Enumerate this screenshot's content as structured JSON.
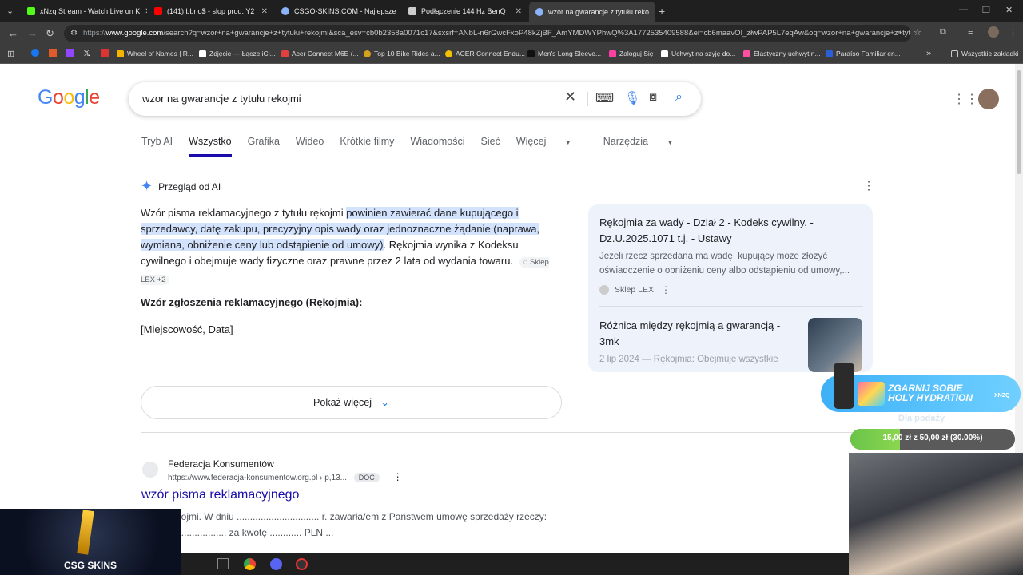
{
  "browser": {
    "tabs": [
      {
        "title": "xNzq Stream - Watch Live on K",
        "color": "#53fc18"
      },
      {
        "title": "(141) bbno$ - slop prod. Y2",
        "color": "#ff0000"
      },
      {
        "title": "CSGO-SKINS.COM - Najlepsze",
        "color": "#8ab4f8"
      },
      {
        "title": "Podłączenie 144 Hz BenQ",
        "color": "#cccccc"
      },
      {
        "title": "wzor na gwarancje z tytułu reko",
        "color": "#8ab4f8"
      }
    ],
    "url_prefix": "https://",
    "url_domain": "www.google.com",
    "url_rest": "/search?q=wzor+na+gwarancje+z+tytułu+rekojmi&sca_esv=cb0b2358a0071c17&sxsrf=ANbL-n6rGwcFxoP48kZjBF_AmYMDWYPhwQ%3A1772535409588&ei=cb6maavOI_złwPAP5L7eqAw&oq=wzor+na+gwarancje+z+tytu+...",
    "bookmarks": [
      {
        "label": "Wheel of Names | R...",
        "color": "#f4b400"
      },
      {
        "label": "Zdjęcie — Łącze iCl...",
        "color": "#ffffff"
      },
      {
        "label": "Acer Connect M6E (...",
        "color": "#e04040"
      },
      {
        "label": "Top 10 Bike Rides a...",
        "color": "#d6a21e"
      },
      {
        "label": "ACER Connect Endu...",
        "color": "#f2c200"
      },
      {
        "label": "Men's Long Sleeve...",
        "color": "#000000"
      },
      {
        "label": "Zaloguj Się",
        "color": "#ff3fa4"
      },
      {
        "label": "Uchwyt na szyję do...",
        "color": "#ffffff"
      },
      {
        "label": "Elastyczny uchwyt n...",
        "color": "#ff4fa0"
      },
      {
        "label": "Paraíso Familiar en...",
        "color": "#2b5fd9"
      }
    ],
    "all_bookmarks": "Wszystkie zakładki"
  },
  "search": {
    "query": "wzor na gwarancje z tytułu rekojmi",
    "tabs": [
      "Tryb AI",
      "Wszystko",
      "Grafika",
      "Wideo",
      "Krótkie filmy",
      "Wiadomości",
      "Sieć",
      "Więcej",
      "Narzędzia"
    ],
    "active_tab": "Wszystko"
  },
  "ai_overview": {
    "heading": "Przegląd od AI",
    "p1_lead": "Wzór pisma reklamacyjnego z tytułu rękojmi ",
    "p1_highlight": "powinien zawierać dane kupującego i sprzedawcy, datę zakupu, precyzyjny opis wady oraz jednoznaczne żądanie (naprawa, wymiana, obniżenie ceny lub odstąpienie od umowy)",
    "p1_tail": ". Rękojmia wynika z Kodeksu cywilnego i obejmuje wady fizyczne oraz prawne przez 2 lata od wydania towaru.",
    "source_chip": "Sklep LEX +2",
    "subheading": "Wzór zgłoszenia reklamacyjnego (Rękojmia):",
    "placeholder_line": "[Miejscowość, Data]",
    "show_more": "Pokaż więcej",
    "sources": [
      {
        "title": "Rękojmia za wady - Dział 2 - Kodeks cywilny. - Dz.U.2025.1071 t.j. - Ustawy",
        "snippet": "Jeżeli rzecz sprzedana ma wadę, kupujący może złożyć oświadczenie o obniżeniu ceny albo odstąpieniu od umowy,...",
        "site": "Sklep LEX"
      },
      {
        "title": "Różnica między rękojmią a gwarancją - 3mk",
        "snippet": "2 lip 2024 — Rękojmia: Obejmuje wszystkie"
      }
    ]
  },
  "result": {
    "site": "Federacja Konsumentów",
    "url": "https://www.federacja-konsumentow.org.pl › p,13...",
    "badge": "DOC",
    "title": "wzór pisma reklamacyjnego",
    "snippet_line1": "rękojmi. W dniu ............................... r. zawarła/em z Państwem umowę sprzedaży rzeczy:",
    "snippet_line2": "...................... za kwotę ............ PLN ..."
  },
  "stream_overlay": {
    "brand": "CSG SKINS",
    "promo_line1": "ZGARNIJ SOBIE",
    "promo_line2": "HOLY HYDRATION",
    "promo_tag": "XNZQ",
    "goal_label": "Dla podaży",
    "goal_text": "15,00 zł z 50,00 zł (30.00%)",
    "goal_fraction": 0.3
  }
}
